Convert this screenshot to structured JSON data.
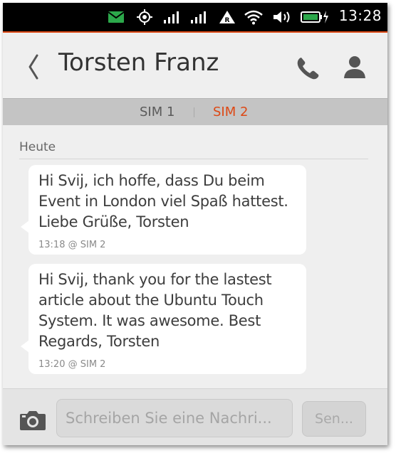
{
  "status_bar": {
    "time": "13:28",
    "icons": [
      "message-icon",
      "gps-icon",
      "signal-1-icon",
      "signal-2-icon",
      "roaming-icon",
      "wifi-icon",
      "volume-icon",
      "battery-charging-icon"
    ],
    "colors": {
      "message": "#2ca84b",
      "battery": "#2ca84b",
      "accent": "#dd4814"
    }
  },
  "header": {
    "contact_name": "Torsten Franz"
  },
  "sim_selector": {
    "tabs": [
      {
        "label": "SIM 1",
        "selected": false
      },
      {
        "label": "SIM 2",
        "selected": true
      }
    ]
  },
  "conversation": {
    "day_label": "Heute",
    "messages": [
      {
        "text": "Hi Svij, ich hoffe, dass Du beim Event in London viel Spaß hattest. Liebe Grüße, Torsten",
        "meta": "13:18 @ SIM 2"
      },
      {
        "text": "Hi Svij, thank you for the lastest article about the Ubuntu Touch System. It was awesome. Best Regards, Torsten",
        "meta": "13:20 @ SIM 2"
      }
    ]
  },
  "composer": {
    "placeholder": "Schreiben Sie eine Nachri...",
    "send_label": "Sen..."
  }
}
